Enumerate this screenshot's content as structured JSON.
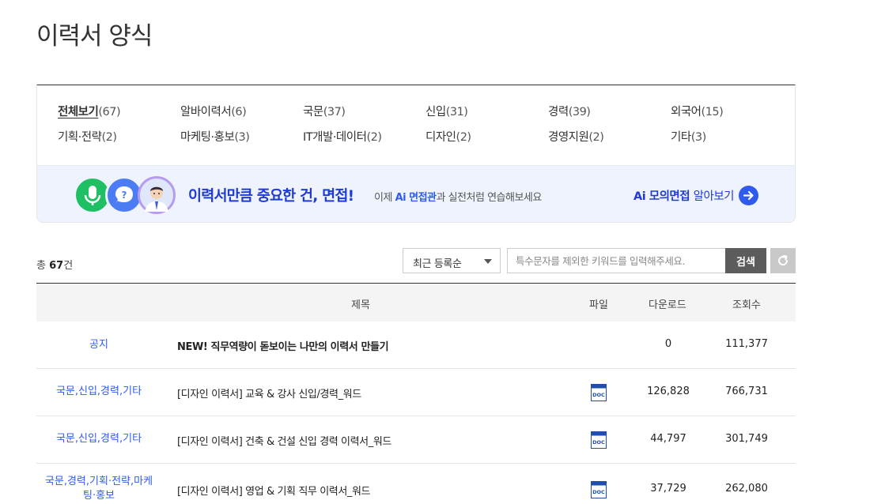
{
  "page_title": "이력서 양식",
  "categories": [
    {
      "label": "전체보기",
      "count": "(67)",
      "active": true
    },
    {
      "label": "알바이력서",
      "count": "(6)"
    },
    {
      "label": "국문",
      "count": "(37)"
    },
    {
      "label": "신입",
      "count": "(31)"
    },
    {
      "label": "경력",
      "count": "(39)"
    },
    {
      "label": "외국어",
      "count": "(15)"
    },
    {
      "label": "기획·전략",
      "count": "(2)"
    },
    {
      "label": "마케팅·홍보",
      "count": "(3)"
    },
    {
      "label": "IT개발·데이터",
      "count": "(2)"
    },
    {
      "label": "디자인",
      "count": "(2)"
    },
    {
      "label": "경영지원",
      "count": "(2)"
    },
    {
      "label": "기타",
      "count": "(3)"
    }
  ],
  "banner": {
    "title": "이력서만큼 중요한 건, 면접!",
    "desc_pre": "이제 ",
    "desc_highlight": "Ai 면접관",
    "desc_post": "과 실전처럼 연습해보세요",
    "link_bold": "Ai 모의면접 ",
    "link_lite": "알아보기"
  },
  "total": {
    "prefix": "총 ",
    "count": "67",
    "suffix": "건"
  },
  "sort": {
    "selected": "최근 등록순"
  },
  "search": {
    "placeholder": "특수문자를 제외한 키워드를 입력해주세요.",
    "button": "검색"
  },
  "table": {
    "headers": {
      "title": "제목",
      "file": "파일",
      "downloads": "다운로드",
      "views": "조회수"
    },
    "rows": [
      {
        "category": "공지",
        "title": "NEW! 직무역량이 돋보이는 나만의 이력서 만들기",
        "downloads": "0",
        "views": "111,377"
      },
      {
        "category": "국문,신입,경력,기타",
        "title": "[디자인 이력서] 교육 & 강사 신입/경력_워드",
        "downloads": "126,828",
        "views": "766,731"
      },
      {
        "category": "국문,신입,경력,기타",
        "title": "[디자인 이력서] 건축 & 건설 신입 경력 이력서_워드",
        "downloads": "44,797",
        "views": "301,749"
      },
      {
        "category_line1": "국문,경력,기획·전략,마케",
        "category_line2": "팅·홍보",
        "title": "[디자인 이력서] 영업 & 기획 직무 이력서_워드",
        "downloads": "37,729",
        "views": "262,080"
      }
    ]
  },
  "colors": {
    "accent_blue": "#2f5bea",
    "banner_bg": "#eef3fd",
    "banner_title": "#1f3bd6",
    "search_button": "#5c5c5c"
  },
  "icons": {
    "mic": "microphone-icon",
    "question": "question-bubble-icon",
    "interviewer": "person-avatar-icon",
    "arrow": "arrow-right-icon",
    "reset": "refresh-icon",
    "doc": "doc-file-icon"
  }
}
